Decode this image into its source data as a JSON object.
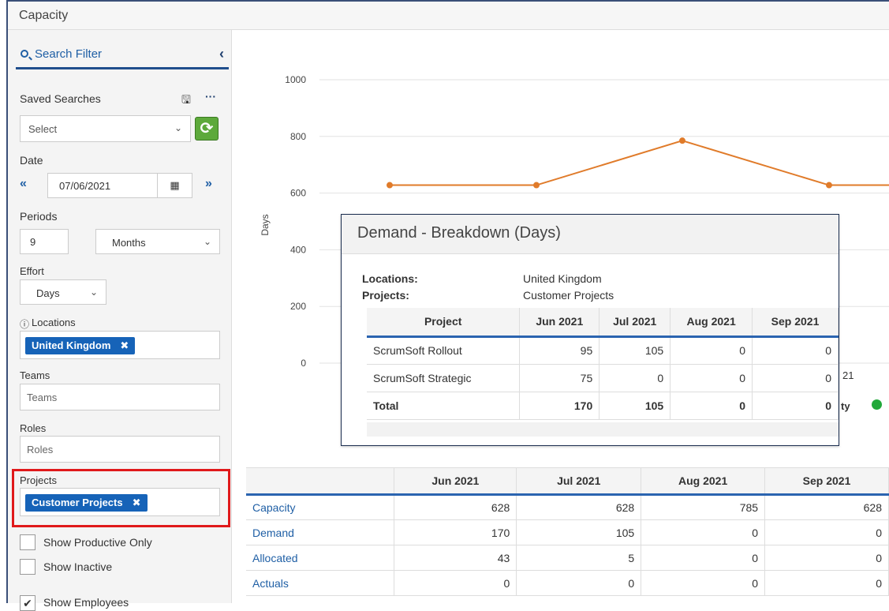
{
  "window": {
    "title": "Capacity"
  },
  "sidebar": {
    "search_filter_label": "Search Filter",
    "saved_searches_label": "Saved Searches",
    "saved_searches_select": "Select",
    "date_label": "Date",
    "date_value": "07/06/2021",
    "periods_label": "Periods",
    "periods_value": "9",
    "periods_unit": "Months",
    "effort_label": "Effort",
    "effort_value": "Days",
    "locations_label": "Locations",
    "locations_chip": "United Kingdom",
    "teams_label": "Teams",
    "teams_placeholder": "Teams",
    "roles_label": "Roles",
    "roles_placeholder": "Roles",
    "projects_label": "Projects",
    "projects_chip": "Customer Projects",
    "show_productive_only": "Show Productive Only",
    "show_inactive": "Show Inactive",
    "show_employees": "Show Employees"
  },
  "chart_data": {
    "type": "line",
    "ylabel": "Days",
    "yticks": [
      "1000",
      "800",
      "600",
      "400",
      "200",
      "0"
    ],
    "ylim": [
      0,
      1000
    ],
    "categories": [
      "Jun 2021",
      "Jul 2021",
      "Aug 2021",
      "Sep 2021"
    ],
    "series": [
      {
        "name": "Capacity",
        "values": [
          628,
          628,
          785,
          628
        ],
        "color": "#e07b2a"
      }
    ],
    "partial_labels": [
      "21",
      "ty"
    ]
  },
  "popup": {
    "title": "Demand - Breakdown (Days)",
    "locations_label": "Locations:",
    "locations_value": "United Kingdom",
    "projects_label": "Projects:",
    "projects_value": "Customer Projects",
    "headers": [
      "Project",
      "Jun 2021",
      "Jul 2021",
      "Aug 2021",
      "Sep 2021"
    ],
    "rows": [
      [
        "ScrumSoft Rollout",
        "95",
        "105",
        "0",
        "0"
      ],
      [
        "ScrumSoft Strategic",
        "75",
        "0",
        "0",
        "0"
      ],
      [
        "Total",
        "170",
        "105",
        "0",
        "0"
      ]
    ]
  },
  "grid": {
    "headers": [
      "",
      "Jun 2021",
      "Jul 2021",
      "Aug 2021",
      "Sep 2021"
    ],
    "rows": [
      [
        "Capacity",
        "628",
        "628",
        "785",
        "628"
      ],
      [
        "Demand",
        "170",
        "105",
        "0",
        "0"
      ],
      [
        "Allocated",
        "43",
        "5",
        "0",
        "0"
      ],
      [
        "Actuals",
        "0",
        "0",
        "0",
        "0"
      ]
    ]
  },
  "colors": {
    "accent": "#1f5fa5",
    "chip": "#1663b8",
    "highlight": "#e0191b",
    "line": "#e07b2a",
    "legend_dot": "#22a83a"
  }
}
